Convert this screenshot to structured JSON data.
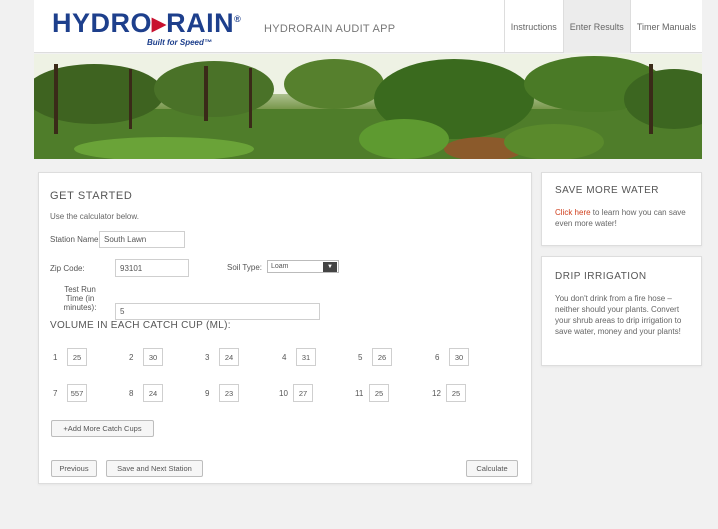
{
  "header": {
    "logo_text_a": "HYDRO",
    "logo_arrow": "▸",
    "logo_text_b": "RAIN",
    "logo_reg": "®",
    "logo_tagline": "Built for Speed™",
    "app_title": "HYDRORAIN AUDIT APP",
    "nav": [
      {
        "label": "Instructions"
      },
      {
        "label": "Enter Results",
        "active": true
      },
      {
        "label": "Timer Manuals"
      }
    ]
  },
  "form": {
    "title": "GET STARTED",
    "intro": "Use the calculator below.",
    "station_label": "Station Name:",
    "station_value": "South Lawn",
    "zip_label": "Zip Code:",
    "zip_value": "93101",
    "soil_label": "Soil Type:",
    "soil_value": "Loam",
    "run_label": "Test Run Time (in minutes):",
    "run_value": "5",
    "volume_title": "VOLUME IN EACH CATCH CUP (ML):",
    "cups": [
      {
        "n": "1",
        "v": "25"
      },
      {
        "n": "2",
        "v": "30"
      },
      {
        "n": "3",
        "v": "24"
      },
      {
        "n": "4",
        "v": "31"
      },
      {
        "n": "5",
        "v": "26"
      },
      {
        "n": "6",
        "v": "30"
      },
      {
        "n": "7",
        "v": "557"
      },
      {
        "n": "8",
        "v": "24"
      },
      {
        "n": "9",
        "v": "23"
      },
      {
        "n": "10",
        "v": "27"
      },
      {
        "n": "11",
        "v": "25"
      },
      {
        "n": "12",
        "v": "25"
      }
    ],
    "add_cups_label": "+Add More Catch Cups",
    "previous_label": "Previous",
    "save_next_label": "Save and Next Station",
    "calculate_label": "Calculate"
  },
  "sidebar": {
    "save_title": "SAVE MORE WATER",
    "save_link": "Click here",
    "save_text": " to learn how you can save even more water!",
    "drip_title": "DRIP IRRIGATION",
    "drip_text": "You don't drink from a fire hose – neither should your plants. Convert your shrub areas to drip irrigation to save water, money and your plants!"
  },
  "colors": {
    "brand_blue": "#1d3f8c",
    "brand_red": "#c8102e",
    "link": "#d0401e"
  }
}
